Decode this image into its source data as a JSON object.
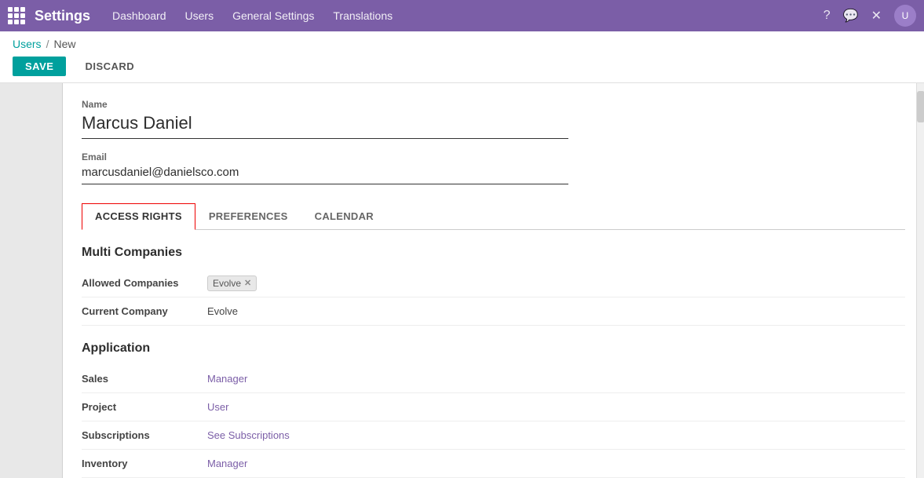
{
  "app": {
    "title": "Settings",
    "grid_icon": "grid-icon"
  },
  "nav": {
    "links": [
      {
        "label": "Dashboard",
        "key": "dashboard"
      },
      {
        "label": "Users",
        "key": "users"
      },
      {
        "label": "General Settings",
        "key": "general-settings"
      },
      {
        "label": "Translations",
        "key": "translations"
      }
    ],
    "icons": {
      "help": "?",
      "chat": "💬",
      "close": "✕",
      "avatar": "U"
    }
  },
  "breadcrumb": {
    "parent": "Users",
    "separator": "/",
    "current": "New"
  },
  "actions": {
    "save": "SAVE",
    "discard": "DISCARD"
  },
  "form": {
    "name_label": "Name",
    "name_value": "Marcus Daniel",
    "email_label": "Email",
    "email_value": "marcusdaniel@danielsco.com"
  },
  "tabs": [
    {
      "label": "ACCESS RIGHTS",
      "active": true
    },
    {
      "label": "PREFERENCES",
      "active": false
    },
    {
      "label": "CALENDAR",
      "active": false
    }
  ],
  "sections": {
    "multi_companies": {
      "title": "Multi Companies",
      "fields": [
        {
          "label": "Allowed Companies",
          "value": "Evolve",
          "type": "tag"
        },
        {
          "label": "Current Company",
          "value": "Evolve",
          "type": "text"
        }
      ]
    },
    "application": {
      "title": "Application",
      "fields": [
        {
          "label": "Sales",
          "value": "Manager",
          "type": "link"
        },
        {
          "label": "Project",
          "value": "User",
          "type": "link"
        },
        {
          "label": "Subscriptions",
          "value": "See Subscriptions",
          "type": "link"
        },
        {
          "label": "Inventory",
          "value": "Manager",
          "type": "link"
        }
      ]
    }
  }
}
